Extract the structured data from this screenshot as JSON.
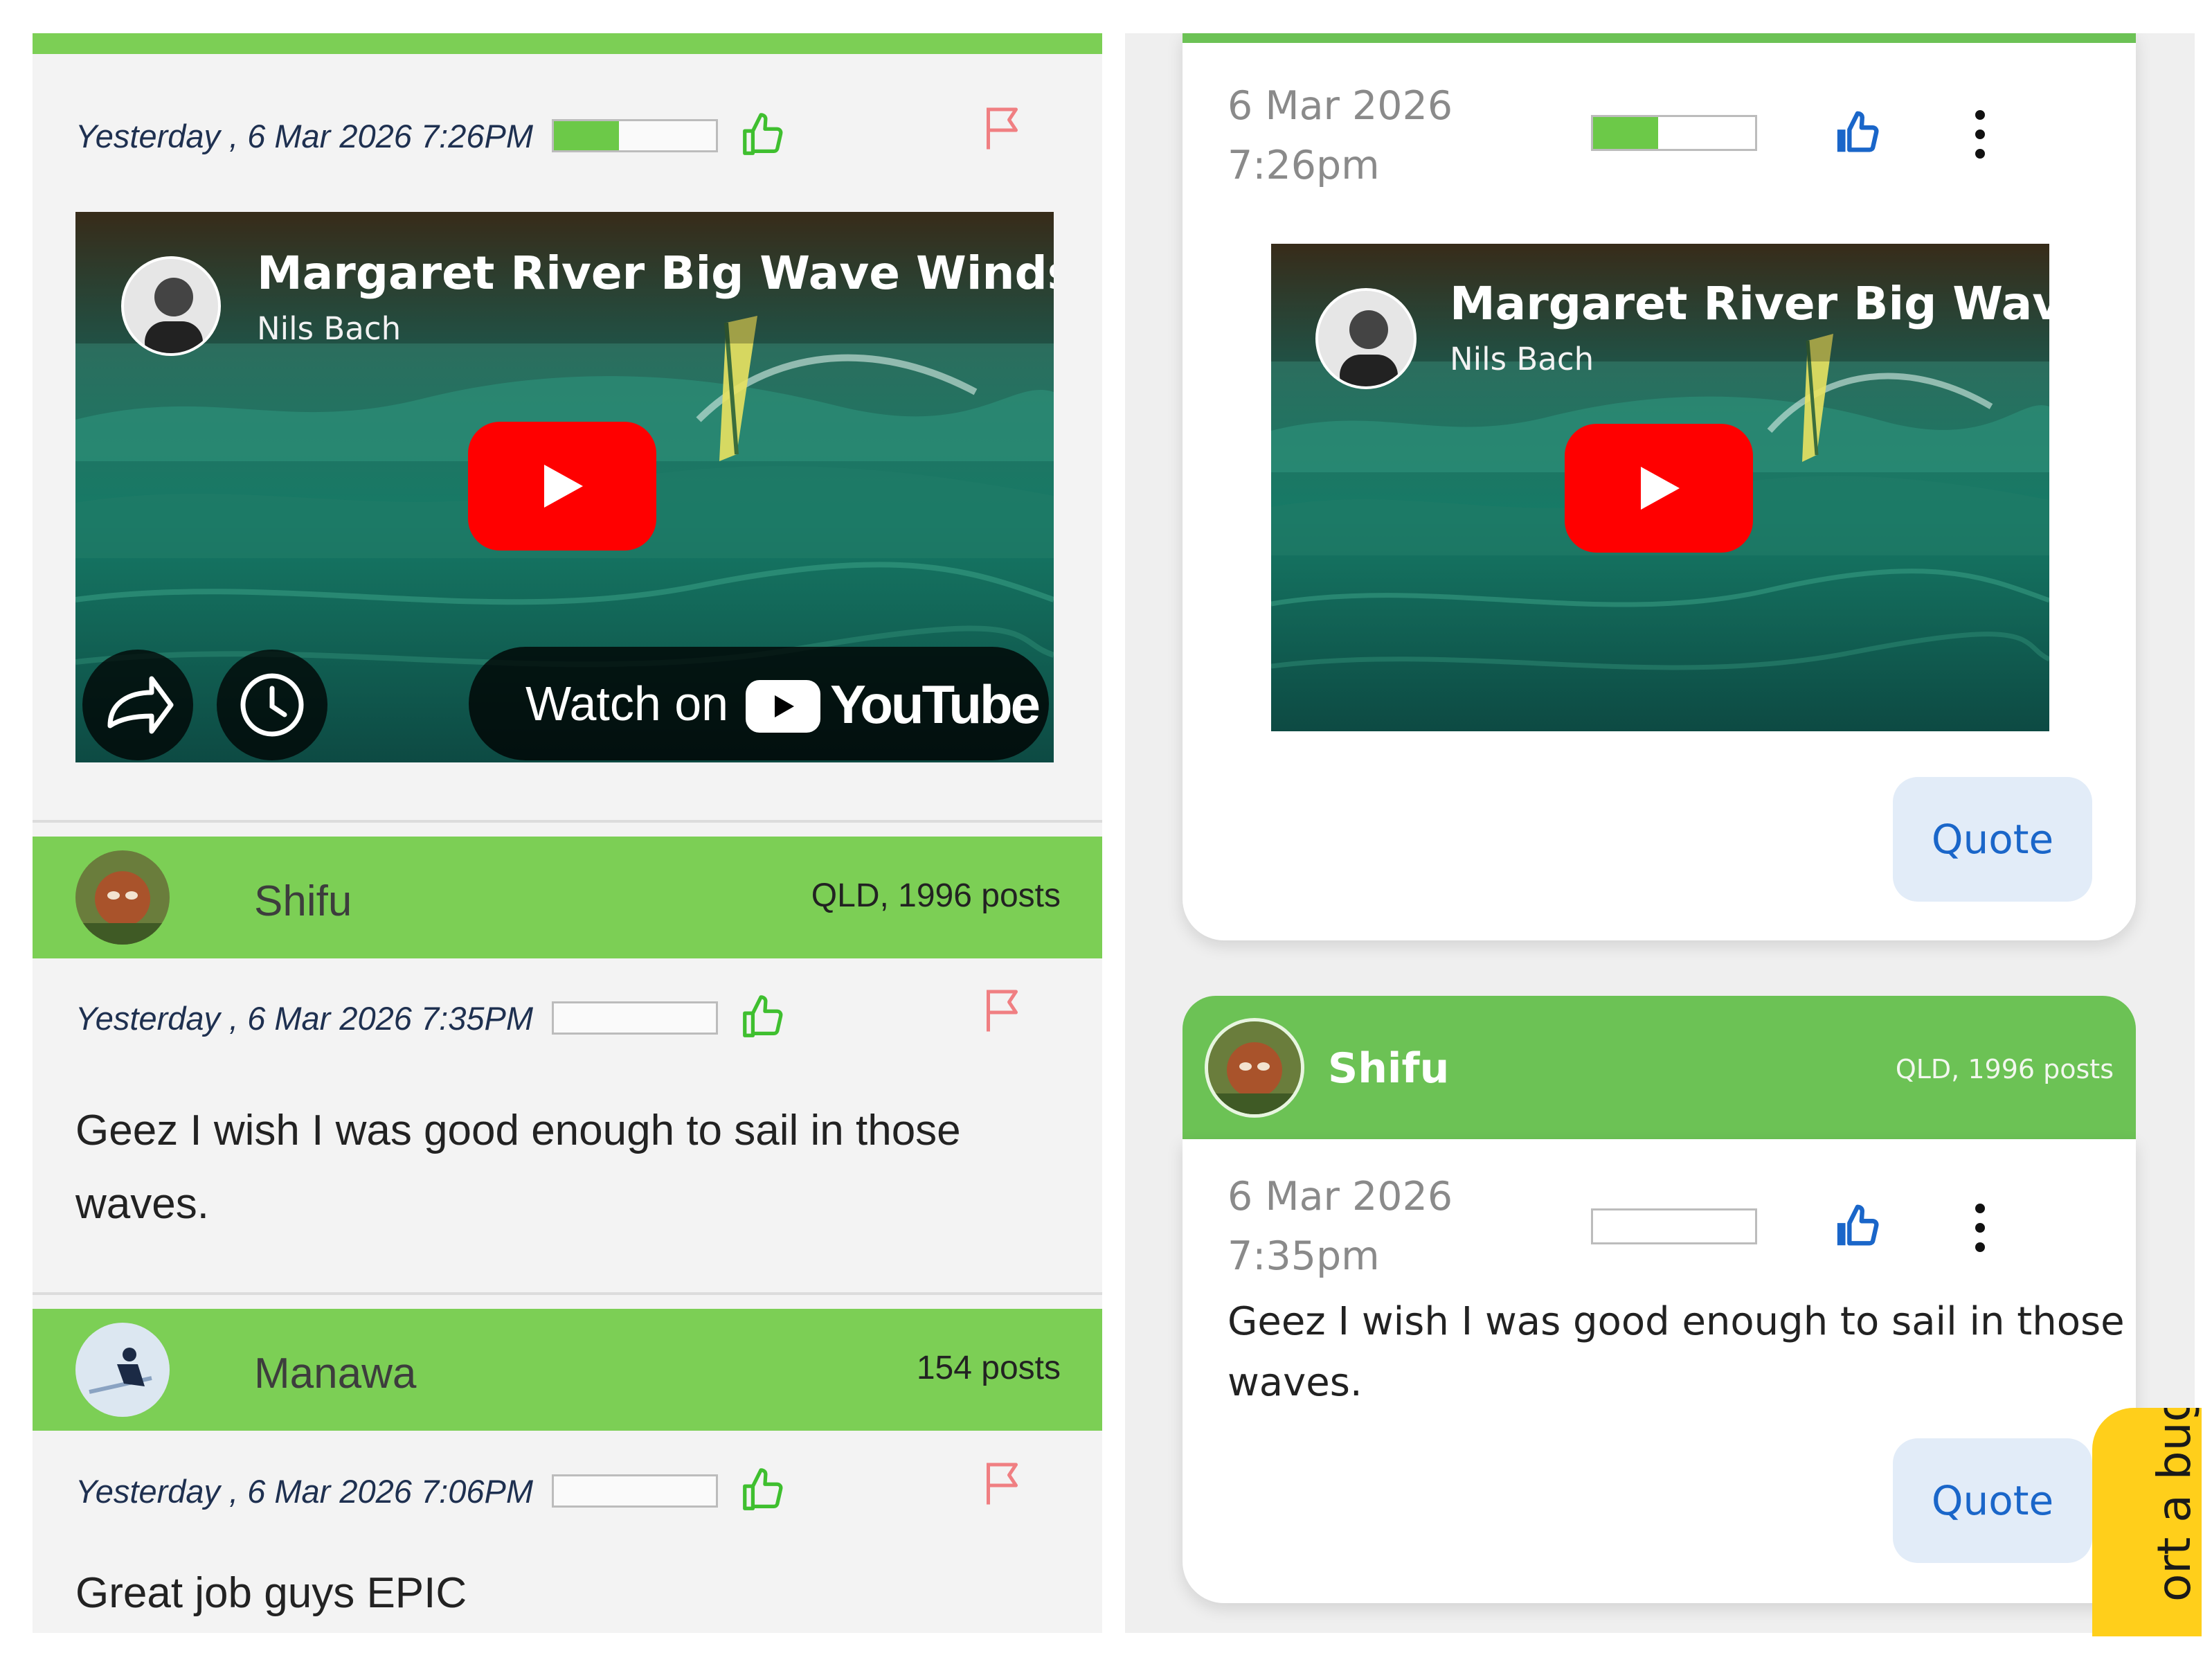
{
  "left": {
    "post1": {
      "date": "Yesterday , 6 Mar 2026 7:26PM",
      "rating": 0.4,
      "video": {
        "title": "Margaret River Big Wave Windsu",
        "channel": "Nils Bach",
        "watch_label": "Watch on",
        "youtube_label": "YouTube"
      }
    },
    "post2": {
      "user": "Shifu",
      "user_stats": "QLD, 1996 posts",
      "date": "Yesterday , 6 Mar 2026 7:35PM",
      "rating": 0,
      "body": "Geez I wish I was good enough to sail in those waves."
    },
    "post3": {
      "user": "Manawa",
      "user_stats": "154 posts",
      "date": "Yesterday , 6 Mar 2026 7:06PM",
      "rating": 0,
      "body": "Great job guys EPIC"
    }
  },
  "right": {
    "post1": {
      "date_line1": "6 Mar 2026",
      "date_line2": "7:26pm",
      "rating": 0.4,
      "video": {
        "title": "Margaret River Big Wave",
        "channel": "Nils Bach"
      },
      "quote_label": "Quote"
    },
    "post2": {
      "user": "Shifu",
      "user_stats": "QLD, 1996 posts",
      "date_line1": "6 Mar 2026",
      "date_line2": "7:35pm",
      "rating": 0,
      "body": "Geez I wish I was good enough to sail in those waves.",
      "quote_label": "Quote"
    },
    "bug_tab": "ort a bug"
  },
  "colors": {
    "forum_green_left": "#7ccf55",
    "forum_green_right": "#6cc255",
    "quote_blue": "#1a66c9",
    "bug_yellow": "#ffcf1b",
    "youtube_red": "#ff0000"
  }
}
